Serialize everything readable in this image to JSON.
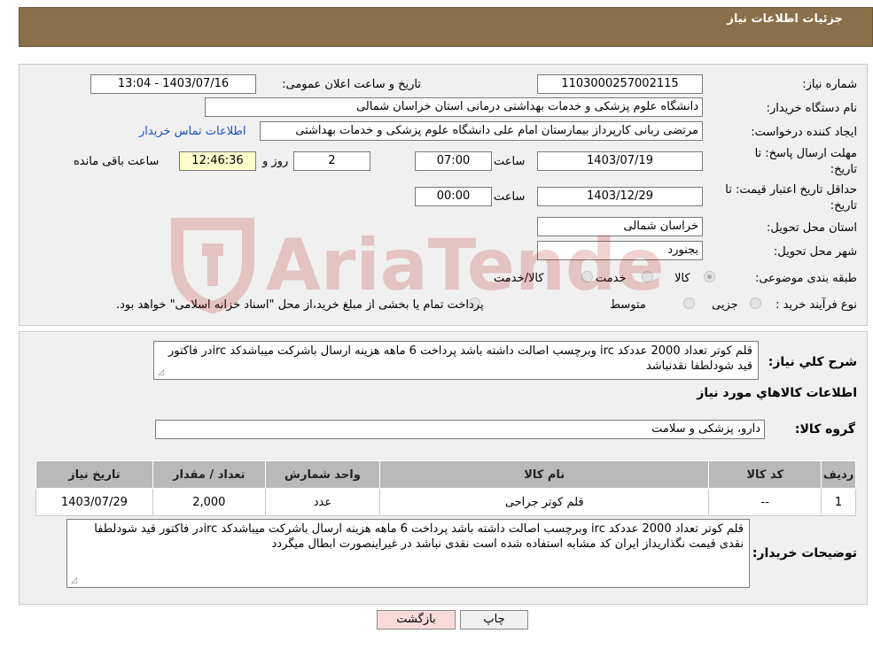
{
  "header": {
    "title": "جزئیات اطلاعات نیاز"
  },
  "form": {
    "need_number": {
      "label": "شماره نیاز:",
      "value": "1103000257002115"
    },
    "announce_datetime": {
      "label": "تاریخ و ساعت اعلان عمومی:",
      "value": "1403/07/16 - 13:04"
    },
    "buyer_org": {
      "label": "نام دستگاه خریدار:",
      "value": "دانشگاه علوم پزشکی و خدمات بهداشتی درمانی استان خراسان شمالی"
    },
    "requester": {
      "label": "ایجاد کننده درخواست:",
      "value": "مرتضی ربانی کارپرداز بیمارستان امام علی دانشگاه علوم پزشکی و خدمات بهداشتی",
      "contact_link": "اطلاعات تماس خریدار"
    },
    "deadline": {
      "label_line1": "مهلت ارسال پاسخ: تا",
      "label_line2": "تاریخ:",
      "date": "1403/07/19",
      "time_label": "ساعت",
      "time": "07:00",
      "days": "2",
      "days_label": "روز و",
      "remaining": "12:46:36",
      "remaining_label": "ساعت باقی مانده"
    },
    "validity": {
      "label_line1": "حداقل تاریخ اعتبار قیمت: تا",
      "label_line2": "تاریخ:",
      "date": "1403/12/29",
      "time_label": "ساعت",
      "time": "00:00"
    },
    "province": {
      "label": "استان محل تحویل:",
      "value": "خراسان شمالی"
    },
    "city": {
      "label": "شهر محل تحویل:",
      "value": "بجنورد"
    },
    "category": {
      "label": "طبقه بندی موضوعی:",
      "options": [
        "کالا",
        "خدمت",
        "کالا/خدمت"
      ],
      "selected": "کالا"
    },
    "process": {
      "label": "نوع فرآیند خرید :",
      "options": [
        "جزیی",
        "متوسط"
      ],
      "selected": "جزیی",
      "note": "پرداخت تمام یا بخشی از مبلغ خرید،از محل \"اسناد خزانه اسلامی\" خواهد بود."
    }
  },
  "description": {
    "label": "شرح کلي نياز:",
    "text": "قلم کوتر تعداد 2000 عددکد irc وبرچسب اصالت داشته باشد پرداخت 6 ماهه هزینه ارسال باشرکت میباشدکد ircدر فاکتور قید شودلطفا نقدنباشد"
  },
  "goods": {
    "title": "اطلاعات کالاهاي مورد نياز",
    "group_label": "گروه کالا:",
    "group_value": "دارو، پزشکی و سلامت",
    "columns": [
      "رديف",
      "کد کالا",
      "نام کالا",
      "واحد شمارش",
      "تعداد / مقدار",
      "تاریخ نیاز"
    ],
    "rows": [
      [
        "1",
        "--",
        "قلم کوتر جراحی",
        "عدد",
        "2,000",
        "1403/07/29"
      ]
    ]
  },
  "buyer_notes": {
    "label": "توضیحات خریدار:",
    "text": "قلم کوتر تعداد 2000 عددکد irc وبرچسب اصالت داشته باشد پرداخت 6 ماهه هزینه ارسال باشرکت میباشدکد ircدر فاکتور قید شودلطفا نقدی قیمت نگذاریداز ایران کد مشابه استفاده شده است نقدی نباشد در غیراینصورت ابطال میگردد"
  },
  "buttons": {
    "print": "چاپ",
    "back": "بازگشت"
  },
  "watermark": "AriaTender.neT",
  "colors": {
    "header": "#8b6f4a",
    "panel": "#f0f0f0",
    "table_header": "#b9b9b9",
    "link": "#1a4fd1",
    "back_button": "#f9dada",
    "remaining_box": "#ffffcc"
  }
}
